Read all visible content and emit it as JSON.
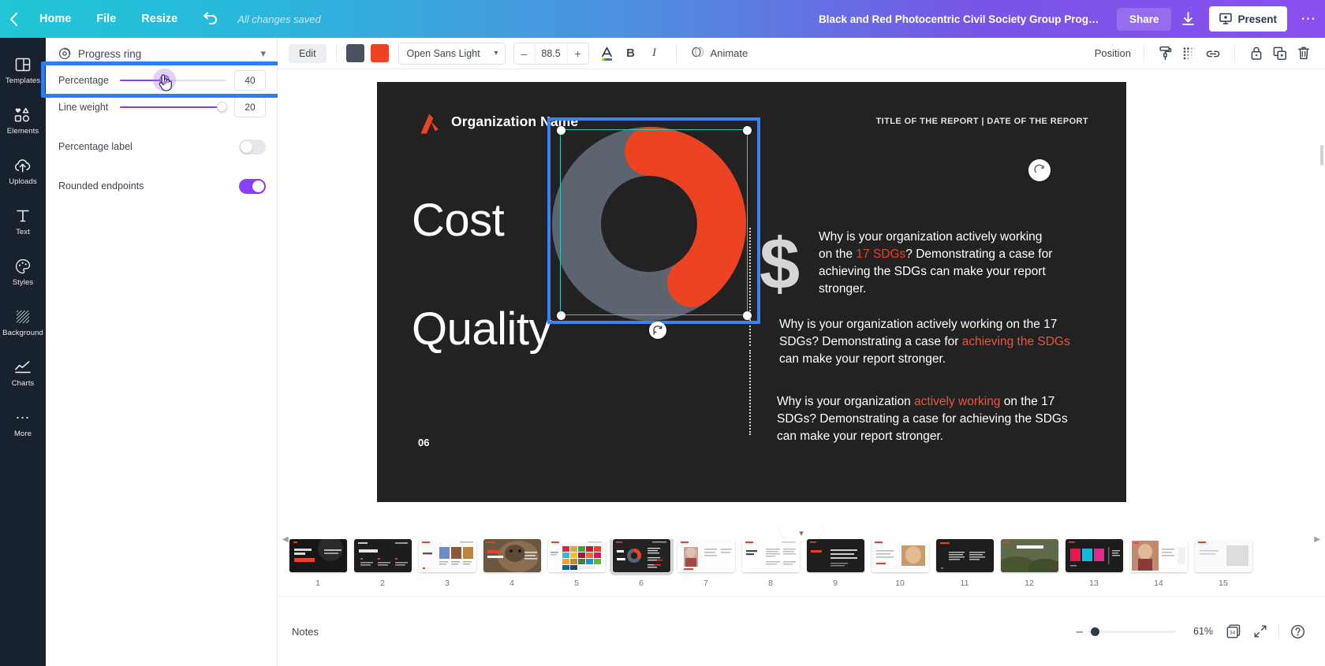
{
  "topbar": {
    "back_icon": "chevron-left-icon",
    "home": "Home",
    "file": "File",
    "resize": "Resize",
    "undo_icon": "undo-arrow-icon",
    "saved_status": "All changes saved",
    "doc_title": "Black and Red Photocentric Civil Society Group Progress Re...",
    "share": "Share",
    "download_icon": "download-icon",
    "present": "Present",
    "present_icon": "presentation-screen-icon",
    "more_icon": "ellipsis-icon",
    "gradient_from": "#22c6d8",
    "gradient_to": "#8b4ff0"
  },
  "rail": {
    "items": [
      {
        "label": "Templates",
        "icon": "templates-grid-icon"
      },
      {
        "label": "Elements",
        "icon": "shapes-icon"
      },
      {
        "label": "Uploads",
        "icon": "cloud-upload-icon"
      },
      {
        "label": "Text",
        "icon": "text-t-icon"
      },
      {
        "label": "Styles",
        "icon": "palette-icon"
      },
      {
        "label": "Background",
        "icon": "hatch-pattern-icon"
      },
      {
        "label": "Charts",
        "icon": "line-chart-icon"
      },
      {
        "label": "More",
        "icon": "ellipsis-icon"
      }
    ]
  },
  "panel": {
    "header_icon": "progress-ring-icon",
    "header_title": "Progress ring",
    "collapse_icon": "chevron-down-icon",
    "percentage": {
      "label": "Percentage",
      "value": "40",
      "fill_pct": 40
    },
    "line_weight": {
      "label": "Line weight",
      "value": "20",
      "fill_pct": 100
    },
    "percentage_label": {
      "label": "Percentage label",
      "state": "off"
    },
    "rounded_endpoints": {
      "label": "Rounded endpoints",
      "state": "on"
    },
    "highlight_color": "#2a7ef0",
    "accent_color": "#8b3ffd"
  },
  "toolbar": {
    "edit": "Edit",
    "swatch_1": "#4a525e",
    "swatch_2": "#ee4323",
    "font_name": "Open Sans Light",
    "font_caret_icon": "chevron-down-icon",
    "size_minus": "–",
    "size_value": "88.5",
    "size_plus": "+",
    "text_color_icon": "text-color-A-icon",
    "bold": "B",
    "italic": "I",
    "animate": "Animate",
    "animate_icon": "animate-icon",
    "position": "Position",
    "copy_style_icon": "paint-roller-icon",
    "transparency_icon": "transparency-icon",
    "link_icon": "link-icon",
    "lock_icon": "lock-icon",
    "duplicate_icon": "duplicate-icon",
    "delete_icon": "trash-icon"
  },
  "slide": {
    "background": "#222222",
    "logo_icon": "organization-logo-icon",
    "logo_color": "#ee4323",
    "org_name": "Organization Name",
    "report_header": "TITLE OF THE REPORT | DATE OF THE REPORT",
    "word_1": "Cost",
    "word_2": "Quality",
    "page_number": "06",
    "dollar_symbol": "$",
    "progress_ring": {
      "percentage": 40,
      "track_color": "#5c6470",
      "fill_color": "#ee4323",
      "rounded_endpoints": true,
      "line_weight": 20
    },
    "text_block_1": {
      "part_1": "Why is your organization actively working on the ",
      "highlight_1": "17 SDGs",
      "part_2": "? Demonstrating a case for achieving the SDGs can make your report stronger."
    },
    "text_block_2": {
      "part_1": "Why is your organization actively working on the 17 SDGs? Demonstrating a case for ",
      "highlight_1": "achieving the SDGs",
      "part_2": " can make your report stronger."
    },
    "text_block_3": {
      "part_1": "Why is your organization ",
      "highlight_1": "actively working",
      "part_2": " on the 17 SDGs? Demonstrating a case for achieving the SDGs can make your report stronger."
    },
    "selection": {
      "outer_color": "#3b82f6",
      "inner_color": "#2fc9b7",
      "rotate_icon": "rotate-handle-icon"
    },
    "refresh_icon": "refresh-circle-icon"
  },
  "strip": {
    "left_arrow_icon": "chevron-left-icon",
    "right_arrow_icon": "chevron-right-icon",
    "collapse_icon": "chevron-down-icon",
    "selected_page": 6,
    "pages": [
      {
        "no": "1",
        "kind": "dark-photo"
      },
      {
        "no": "2",
        "kind": "dark-text"
      },
      {
        "no": "3",
        "kind": "light-photos"
      },
      {
        "no": "4",
        "kind": "photo-bear"
      },
      {
        "no": "5",
        "kind": "light-sdg-grid"
      },
      {
        "no": "6",
        "kind": "dark-ring"
      },
      {
        "no": "7",
        "kind": "light-person"
      },
      {
        "no": "8",
        "kind": "light-text"
      },
      {
        "no": "9",
        "kind": "dark-text2"
      },
      {
        "no": "10",
        "kind": "light-photo2"
      },
      {
        "no": "11",
        "kind": "dark-columns"
      },
      {
        "no": "12",
        "kind": "photo-green"
      },
      {
        "no": "13",
        "kind": "dark-color-blocks"
      },
      {
        "no": "14",
        "kind": "photo-person2"
      },
      {
        "no": "15",
        "kind": "light-edge"
      }
    ]
  },
  "bottombar": {
    "notes": "Notes",
    "zoom_minus_icon": "minus-icon",
    "zoom_percent": "61%",
    "zoom_knob_pct": 8,
    "pages_icon": "pages-count-icon",
    "pages_count": "34",
    "fullscreen_icon": "expand-arrows-icon",
    "help_icon": "question-mark-icon"
  }
}
